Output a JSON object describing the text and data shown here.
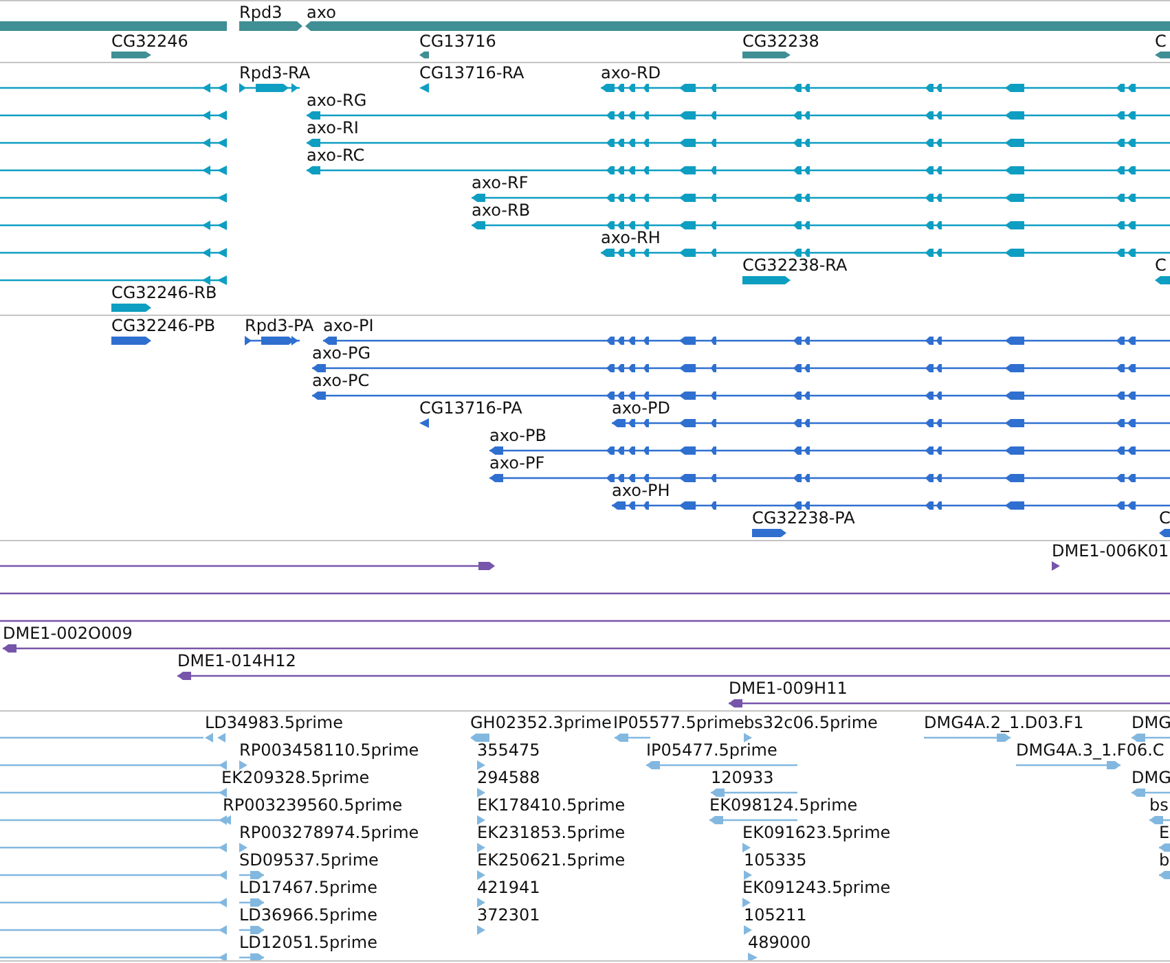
{
  "tracks": [
    {
      "kind": "gene",
      "color": "#3f8f94",
      "features": [
        {
          "label": "Rpd3",
          "forward": true
        },
        {
          "label": "axo",
          "forward": false
        },
        {
          "label": "CG32246",
          "forward": true
        },
        {
          "label": "CG13716",
          "forward": false
        },
        {
          "label": "CG32238",
          "forward": true
        },
        {
          "label": "C",
          "forward": false
        }
      ]
    },
    {
      "kind": "transcript",
      "color": "#0e9ec2",
      "features": [
        {
          "label": "Rpd3-RA",
          "forward": true
        },
        {
          "label": "CG13716-RA",
          "forward": false
        },
        {
          "label": "axo-RD",
          "forward": false
        },
        {
          "label": "axo-RG",
          "forward": false
        },
        {
          "label": "axo-RI",
          "forward": false
        },
        {
          "label": "axo-RC",
          "forward": false
        },
        {
          "label": "axo-RF",
          "forward": false
        },
        {
          "label": "axo-RB",
          "forward": false
        },
        {
          "label": "axo-RH",
          "forward": false
        },
        {
          "label": "CG32238-RA",
          "forward": true
        },
        {
          "label": "C",
          "forward": false
        },
        {
          "label": "CG32246-RB",
          "forward": true
        }
      ]
    },
    {
      "kind": "transcript",
      "color": "#2f6fd0",
      "features": [
        {
          "label": "CG32246-PB",
          "forward": true
        },
        {
          "label": "Rpd3-PA",
          "forward": true
        },
        {
          "label": "axo-PI",
          "forward": false
        },
        {
          "label": "axo-PG",
          "forward": false
        },
        {
          "label": "axo-PC",
          "forward": false
        },
        {
          "label": "CG13716-PA",
          "forward": false
        },
        {
          "label": "axo-PD",
          "forward": false
        },
        {
          "label": "axo-PB",
          "forward": false
        },
        {
          "label": "axo-PF",
          "forward": false
        },
        {
          "label": "axo-PH",
          "forward": false
        },
        {
          "label": "CG32238-PA",
          "forward": true
        },
        {
          "label": "C",
          "forward": false
        }
      ]
    },
    {
      "kind": "clone",
      "color": "#7755aa",
      "features": [
        {
          "label": "DME1-006K01",
          "forward": true
        },
        {
          "label": "DME1-002O009",
          "forward": false
        },
        {
          "label": "DME1-014H12",
          "forward": false
        },
        {
          "label": "DME1-009H11",
          "forward": false
        }
      ]
    },
    {
      "kind": "est",
      "color": "#82b8e0",
      "features": [
        {
          "label": "LD34983.5prime",
          "forward": false
        },
        {
          "label": "RP003458110.5prime",
          "forward": true
        },
        {
          "label": "EK209328.5prime",
          "forward": false
        },
        {
          "label": "RP003239560.5prime",
          "forward": false
        },
        {
          "label": "RP003278974.5prime",
          "forward": true
        },
        {
          "label": "SD09537.5prime",
          "forward": true
        },
        {
          "label": "LD17467.5prime",
          "forward": true
        },
        {
          "label": "LD36966.5prime",
          "forward": true
        },
        {
          "label": "LD12051.5prime",
          "forward": true
        },
        {
          "label": "GH02352.3prime",
          "forward": false
        },
        {
          "label": "355475",
          "forward": true
        },
        {
          "label": "294588",
          "forward": true
        },
        {
          "label": "EK178410.5prime",
          "forward": true
        },
        {
          "label": "EK231853.5prime",
          "forward": true
        },
        {
          "label": "EK250621.5prime",
          "forward": true
        },
        {
          "label": "421941",
          "forward": true
        },
        {
          "label": "372301",
          "forward": true
        },
        {
          "label": "IP05577.5prime",
          "forward": false
        },
        {
          "label": "bs32c06.5prime",
          "forward": true
        },
        {
          "label": "IP05477.5prime",
          "forward": false
        },
        {
          "label": "120933",
          "forward": false
        },
        {
          "label": "EK098124.5prime",
          "forward": false
        },
        {
          "label": "EK091623.5prime",
          "forward": true
        },
        {
          "label": "105335",
          "forward": true
        },
        {
          "label": "EK091243.5prime",
          "forward": true
        },
        {
          "label": "105211",
          "forward": true
        },
        {
          "label": "489000",
          "forward": true
        },
        {
          "label": "DMG4A.2_1.D03.F1",
          "forward": true
        },
        {
          "label": "DMG",
          "forward": false
        },
        {
          "label": "DMG4A.3_1.F06.C",
          "forward": true
        },
        {
          "label": "DMG",
          "forward": false
        },
        {
          "label": "bs",
          "forward": false
        },
        {
          "label": "E",
          "forward": false
        },
        {
          "label": "b",
          "forward": false
        }
      ]
    }
  ]
}
